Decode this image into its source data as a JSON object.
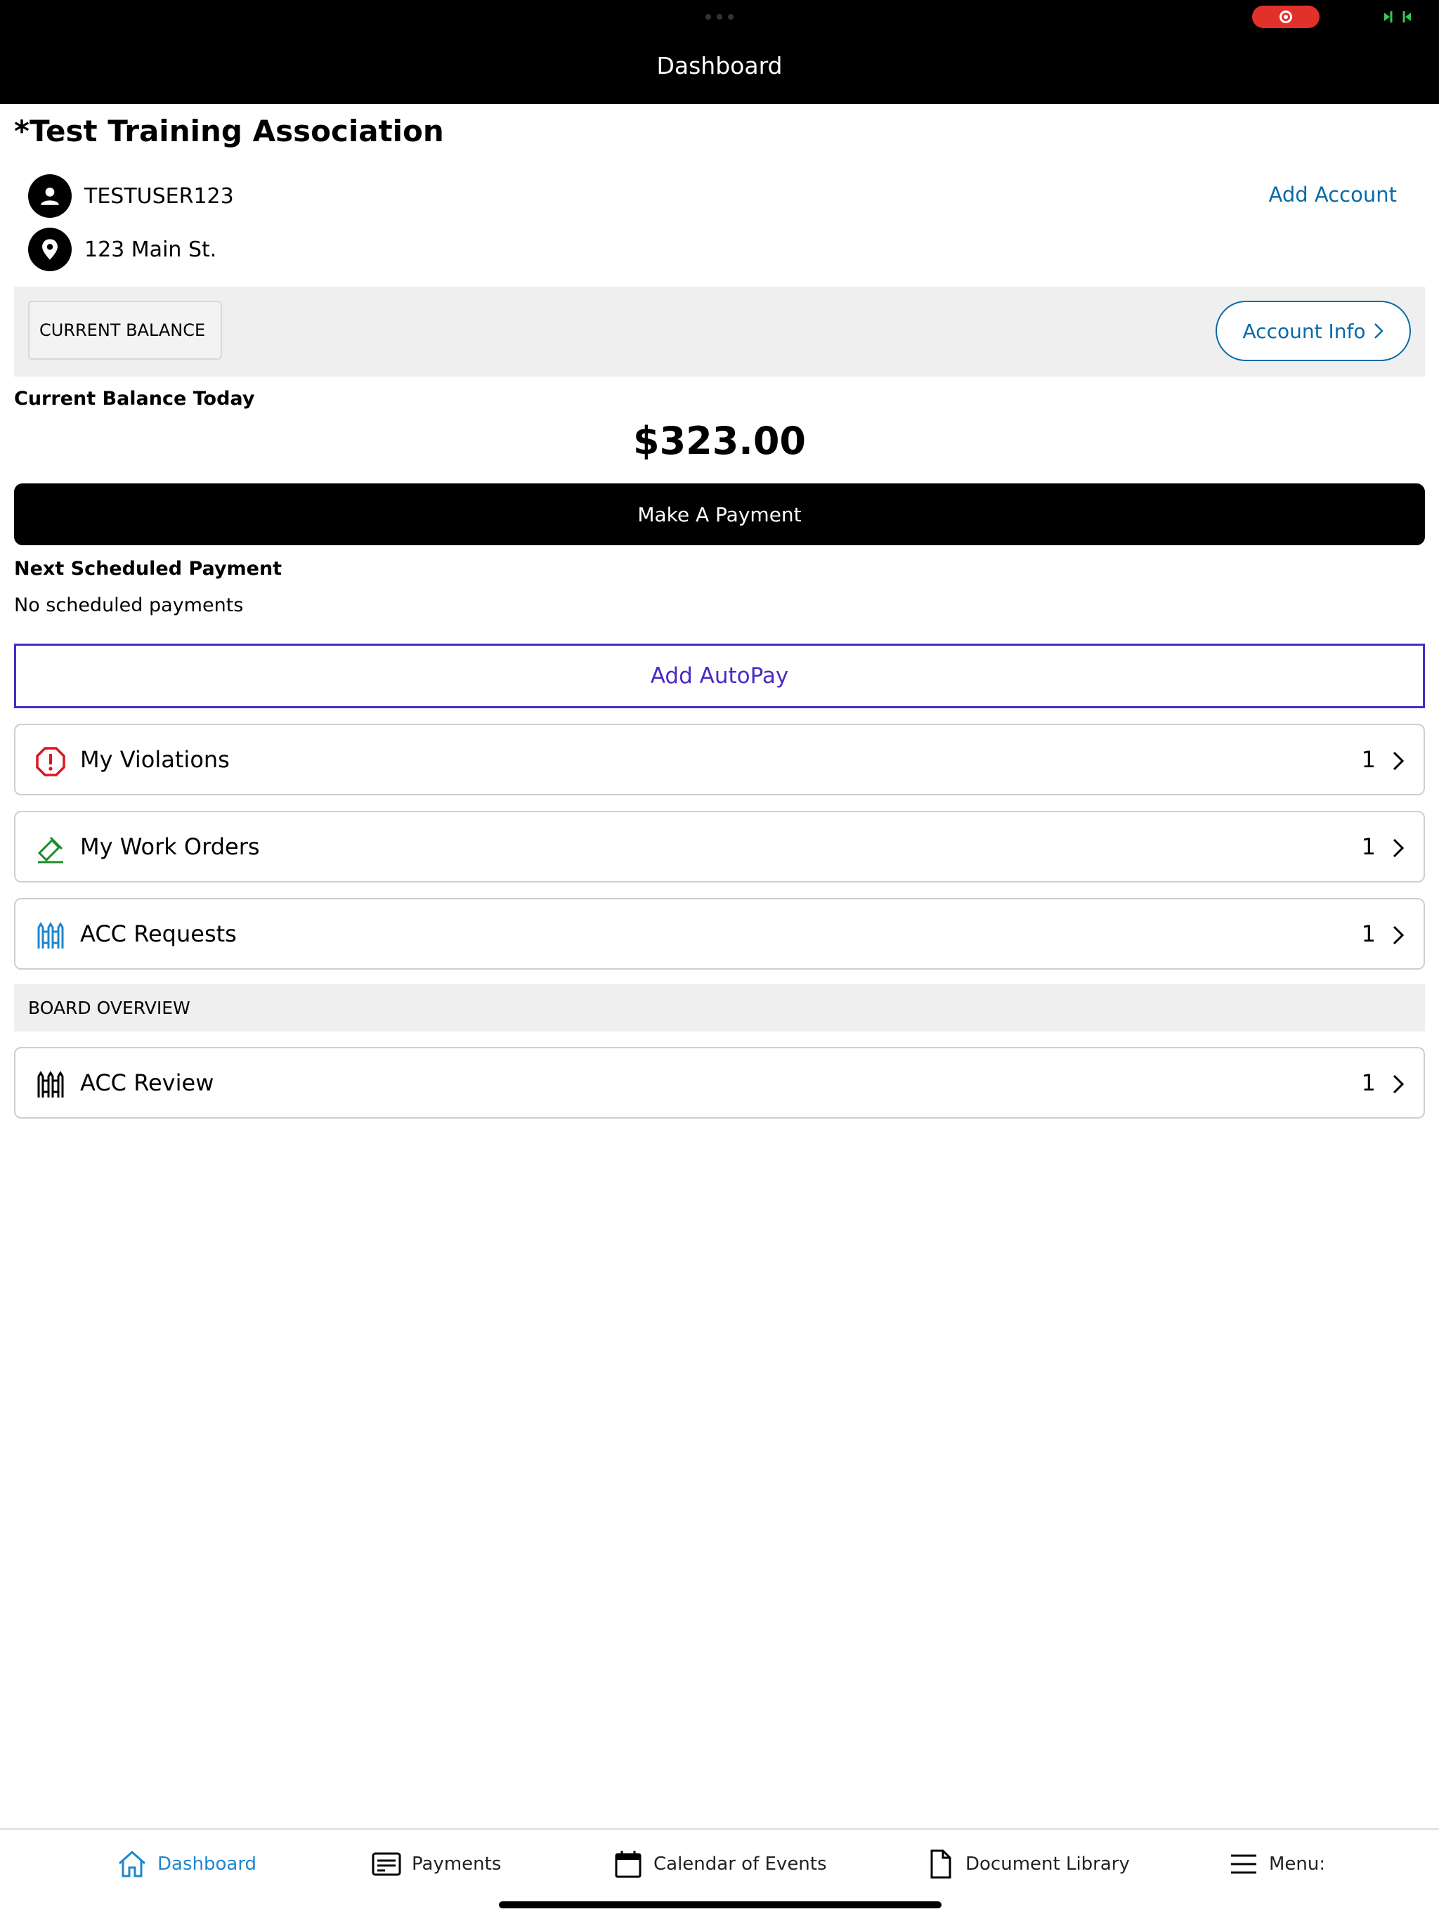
{
  "header": {
    "title": "Dashboard"
  },
  "org": {
    "name": "*Test Training Association"
  },
  "user": {
    "username": "TESTUSER123",
    "address": "123 Main St.",
    "add_account_label": "Add Account"
  },
  "balance": {
    "chip_label": "CURRENT BALANCE",
    "account_info_label": "Account Info",
    "today_label": "Current Balance Today",
    "amount": "$323.00",
    "pay_button_label": "Make A Payment"
  },
  "schedule": {
    "heading": "Next Scheduled Payment",
    "status": "No scheduled payments",
    "autopay_label": "Add AutoPay"
  },
  "items": [
    {
      "label": "My Violations",
      "count": "1",
      "icon": "violation-icon",
      "color": "#e0141e"
    },
    {
      "label": "My Work Orders",
      "count": "1",
      "icon": "work-order-icon",
      "color": "#1e8a2b"
    },
    {
      "label": "ACC Requests",
      "count": "1",
      "icon": "fence-icon",
      "color": "#1f86d1"
    }
  ],
  "board": {
    "heading": "BOARD OVERVIEW",
    "items": [
      {
        "label": "ACC Review",
        "count": "1",
        "icon": "fence-icon",
        "color": "#000000"
      }
    ]
  },
  "tabs": [
    {
      "label": "Dashboard",
      "icon": "home-icon",
      "active": true
    },
    {
      "label": "Payments",
      "icon": "payment-card-icon"
    },
    {
      "label": "Calendar of Events",
      "icon": "calendar-icon"
    },
    {
      "label": "Document Library",
      "icon": "document-icon"
    },
    {
      "label": "Menu:",
      "icon": "hamburger-icon"
    }
  ],
  "colors": {
    "link": "#0a6aa6",
    "autopay": "#4a2bc4",
    "active_tab": "#1f86d1",
    "recording": "#e2312a"
  }
}
